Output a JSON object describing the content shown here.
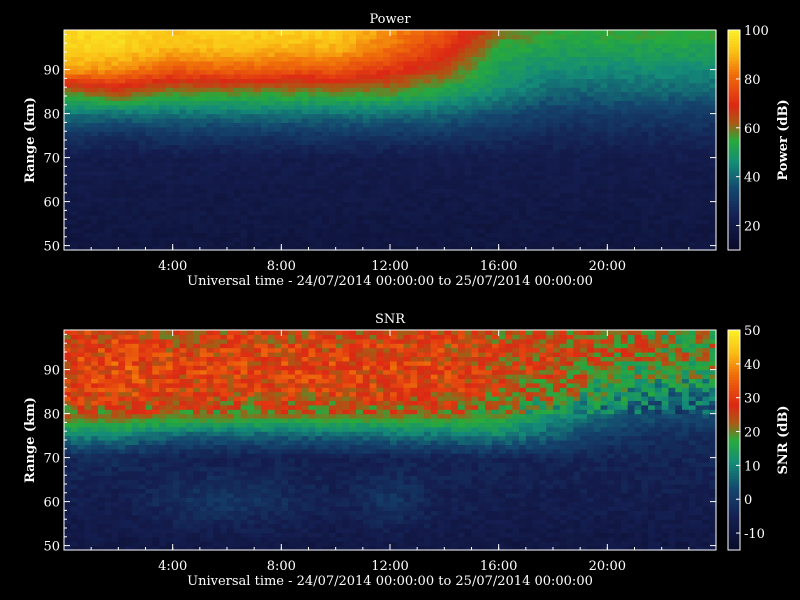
{
  "chart_data": [
    {
      "type": "heatmap",
      "title": "Power",
      "xlabel": "Universal time - 24/07/2014 00:00:00 to 25/07/2014 00:00:00",
      "ylabel": "Range (km)",
      "colorbar_label": "Power (dB)",
      "x_ticks": [
        "4:00",
        "8:00",
        "12:00",
        "16:00",
        "20:00"
      ],
      "x_tick_hours": [
        4,
        8,
        12,
        16,
        20
      ],
      "xlim_hours": [
        0,
        24
      ],
      "y_ticks": [
        50,
        60,
        70,
        80,
        90
      ],
      "ylim": [
        49,
        99
      ],
      "colorbar_ticks": [
        20,
        40,
        60,
        80,
        100
      ],
      "colorbar_range": [
        10,
        100
      ],
      "profile_hours": [
        0,
        2,
        4,
        6,
        8,
        10,
        12,
        14,
        16,
        18,
        20,
        22,
        24
      ],
      "profile_ranges_km": [
        50,
        60,
        70,
        75,
        80,
        85,
        90,
        95,
        99
      ],
      "values": [
        [
          18,
          20,
          22,
          30,
          42,
          58,
          88,
          95,
          96
        ],
        [
          18,
          20,
          22,
          28,
          42,
          65,
          85,
          95,
          96
        ],
        [
          18,
          20,
          22,
          30,
          42,
          58,
          78,
          90,
          92
        ],
        [
          18,
          20,
          22,
          30,
          42,
          58,
          80,
          92,
          95
        ],
        [
          18,
          20,
          22,
          30,
          42,
          58,
          78,
          90,
          94
        ],
        [
          18,
          20,
          22,
          30,
          42,
          58,
          78,
          90,
          94
        ],
        [
          18,
          20,
          22,
          30,
          42,
          58,
          72,
          82,
          86
        ],
        [
          18,
          20,
          22,
          30,
          40,
          52,
          64,
          72,
          78
        ],
        [
          18,
          20,
          22,
          28,
          36,
          46,
          50,
          55,
          62
        ],
        [
          18,
          20,
          22,
          26,
          32,
          40,
          46,
          52,
          56
        ],
        [
          18,
          20,
          22,
          26,
          32,
          40,
          46,
          52,
          56
        ],
        [
          18,
          20,
          22,
          26,
          32,
          40,
          46,
          52,
          56
        ],
        [
          18,
          20,
          22,
          26,
          32,
          40,
          46,
          52,
          56
        ]
      ]
    },
    {
      "type": "heatmap",
      "title": "SNR",
      "xlabel": "Universal time - 24/07/2014 00:00:00 to 25/07/2014 00:00:00",
      "ylabel": "Range (km)",
      "colorbar_label": "SNR (dB)",
      "x_ticks": [
        "4:00",
        "8:00",
        "12:00",
        "16:00",
        "20:00"
      ],
      "x_tick_hours": [
        4,
        8,
        12,
        16,
        20
      ],
      "xlim_hours": [
        0,
        24
      ],
      "y_ticks": [
        50,
        60,
        70,
        80,
        90
      ],
      "ylim": [
        49,
        99
      ],
      "colorbar_ticks": [
        -10,
        0,
        10,
        20,
        30,
        40,
        50
      ],
      "colorbar_range": [
        -15,
        50
      ],
      "profile_hours": [
        0,
        2,
        4,
        6,
        8,
        10,
        12,
        14,
        16,
        18,
        20,
        22,
        24
      ],
      "profile_ranges_km": [
        50,
        60,
        70,
        75,
        80,
        85,
        90,
        95,
        99
      ],
      "values": [
        [
          -8,
          -6,
          -3,
          10,
          24,
          28,
          30,
          28,
          26
        ],
        [
          -8,
          -6,
          -3,
          10,
          24,
          30,
          32,
          30,
          28
        ],
        [
          -8,
          -2,
          -5,
          6,
          22,
          28,
          30,
          28,
          26
        ],
        [
          -8,
          0,
          -5,
          6,
          22,
          28,
          30,
          28,
          26
        ],
        [
          -8,
          -2,
          -5,
          6,
          22,
          28,
          30,
          28,
          26
        ],
        [
          -8,
          -5,
          -5,
          6,
          22,
          28,
          30,
          28,
          26
        ],
        [
          -8,
          0,
          -5,
          8,
          22,
          28,
          30,
          28,
          26
        ],
        [
          -8,
          -5,
          -4,
          8,
          22,
          28,
          30,
          28,
          26
        ],
        [
          -8,
          -6,
          -4,
          10,
          20,
          24,
          26,
          26,
          24
        ],
        [
          -8,
          -6,
          -4,
          6,
          12,
          22,
          26,
          26,
          24
        ],
        [
          -8,
          -6,
          -4,
          0,
          8,
          14,
          20,
          24,
          24
        ],
        [
          -8,
          -6,
          -4,
          -2,
          4,
          10,
          18,
          20,
          20
        ],
        [
          -8,
          -6,
          -4,
          -2,
          4,
          10,
          18,
          20,
          20
        ]
      ]
    }
  ]
}
